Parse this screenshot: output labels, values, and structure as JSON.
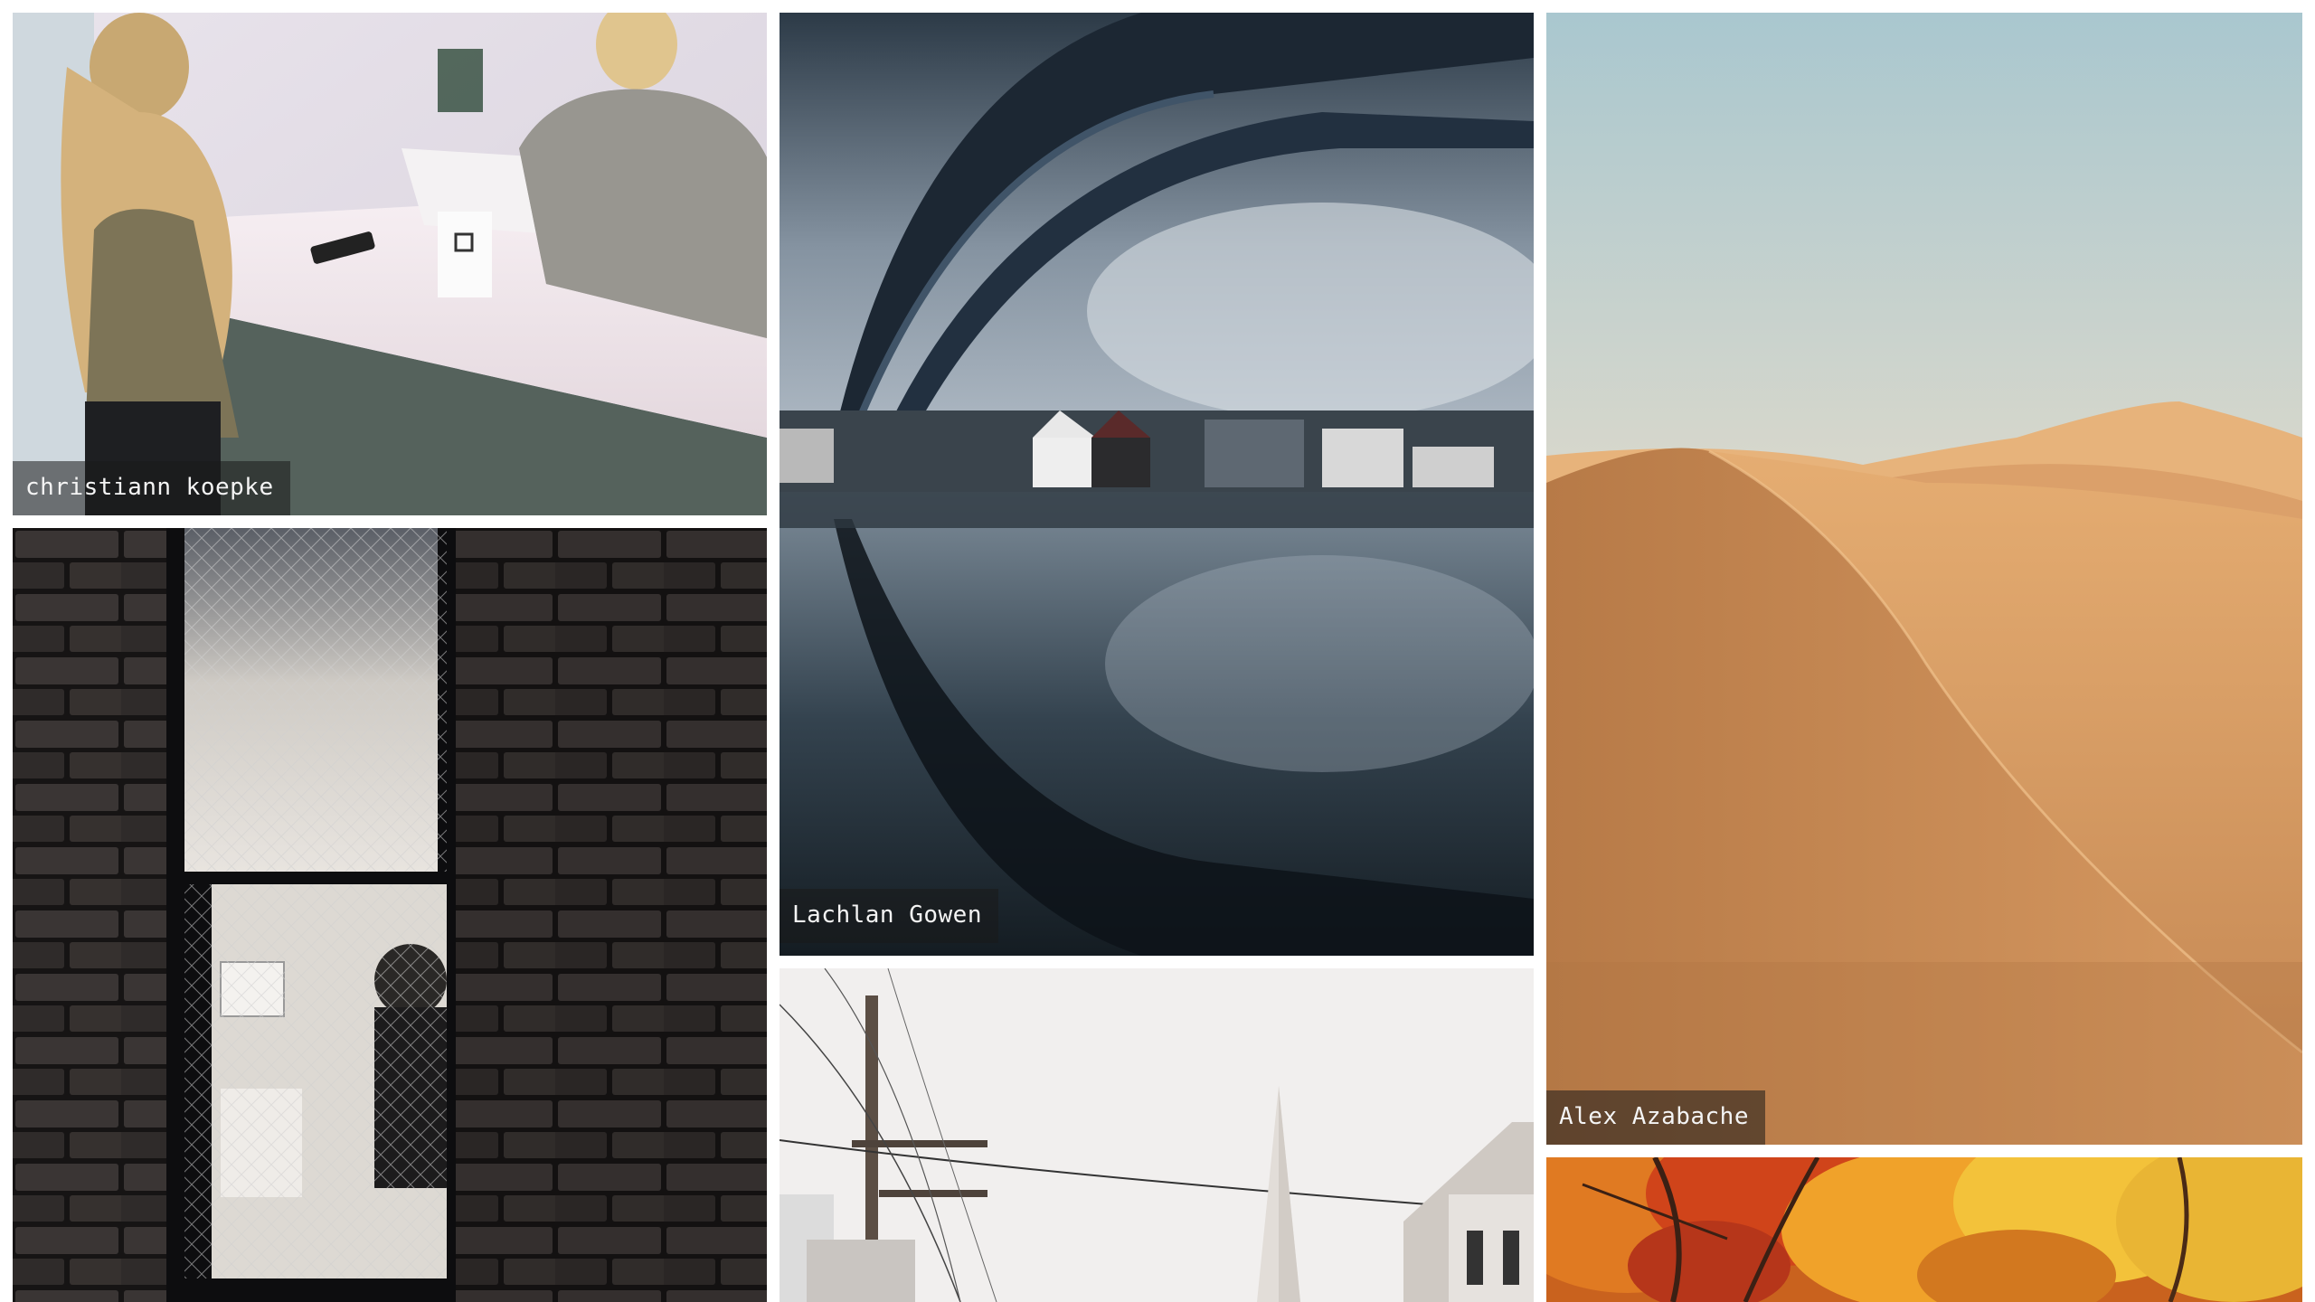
{
  "gallery": {
    "photos": [
      {
        "subject": "checkout-counter",
        "credit": "christiann koepke"
      },
      {
        "subject": "brick-wall-window",
        "credit": ""
      },
      {
        "subject": "bridge-reflection",
        "credit": "Lachlan Gowen"
      },
      {
        "subject": "city-street-powerlines",
        "credit": ""
      },
      {
        "subject": "desert-dunes",
        "credit": "Alex Azabache"
      },
      {
        "subject": "autumn-trees",
        "credit": ""
      }
    ]
  }
}
